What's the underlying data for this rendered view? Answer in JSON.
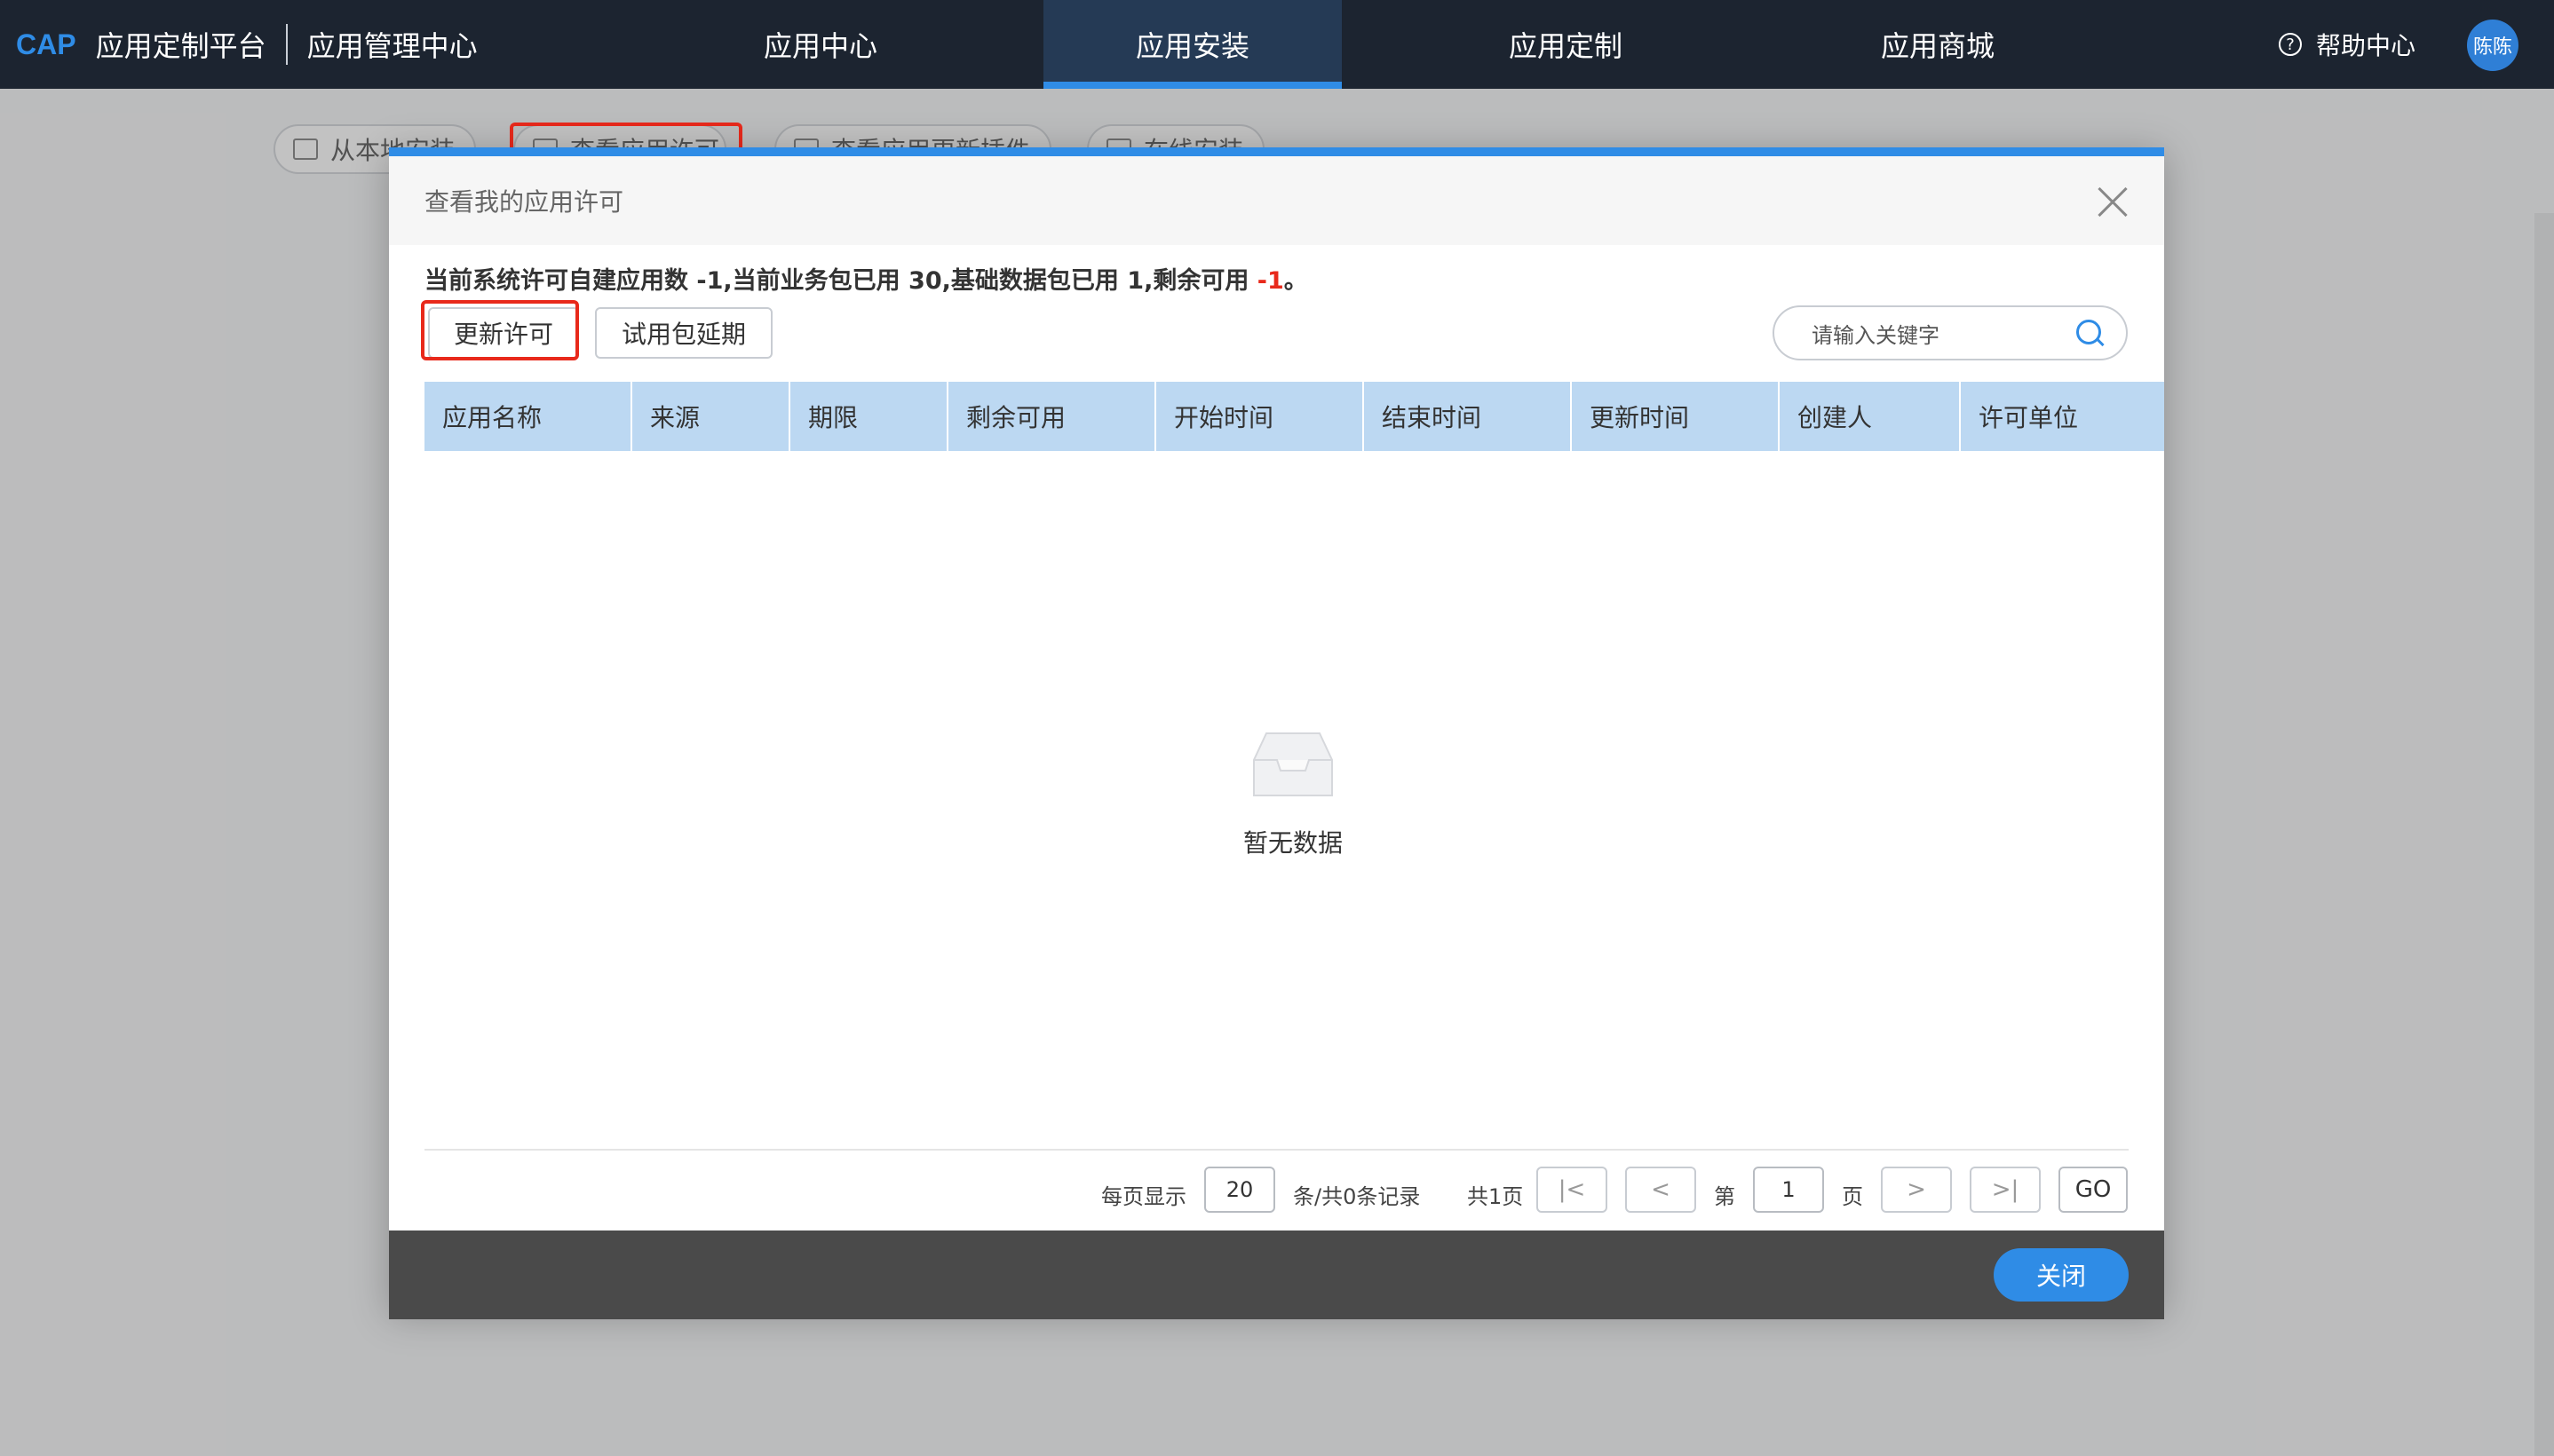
{
  "header": {
    "brand": "CAP",
    "platform_title": "应用定制平台",
    "center_title": "应用管理中心",
    "tabs": [
      {
        "label": "应用中心"
      },
      {
        "label": "应用安装"
      },
      {
        "label": "应用定制"
      },
      {
        "label": "应用商城"
      }
    ],
    "active_tab": "应用安装",
    "help_label": "帮助中心",
    "user_name": "陈陈"
  },
  "toolbar": {
    "buttons": [
      {
        "label": "从本地安装"
      },
      {
        "label": "查看应用许可"
      },
      {
        "label": "查看应用更新插件"
      },
      {
        "label": "在线安装"
      }
    ]
  },
  "modal": {
    "title": "查看我的应用许可",
    "summary_prefix": "当前系统许可自建应用数 -1,当前业务包已用 30,基础数据包已用 1,剩余可用 ",
    "summary_remaining": "-1",
    "summary_suffix": "。",
    "update_button": "更新许可",
    "trial_button": "试用包延期",
    "search_placeholder": "请输入关键字",
    "columns": [
      "应用名称",
      "来源",
      "期限",
      "剩余可用",
      "开始时间",
      "结束时间",
      "更新时间",
      "创建人",
      "许可单位"
    ],
    "empty_text": "暂无数据",
    "pagination": {
      "per_page_label": "每页显示",
      "per_page": "20",
      "records_label": "条/共0条记录",
      "total_pages": "共1页",
      "page_prefix": "第",
      "current_page": "1",
      "page_suffix": "页",
      "go_label": "GO"
    },
    "close_button": "关闭"
  },
  "colors": {
    "topbar": "#1c2430",
    "accent": "#2f8ce6",
    "table_header": "#bcd8f2",
    "highlight": "#e8291b"
  }
}
